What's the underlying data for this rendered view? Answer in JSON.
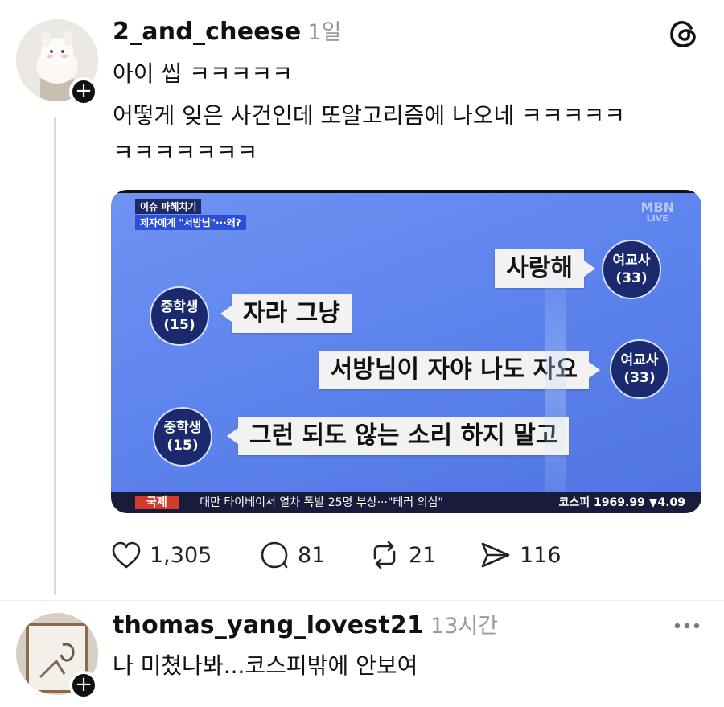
{
  "post": {
    "username": "2_and_cheese",
    "time": "1일",
    "lines": [
      "아이 씹 ㅋㅋㅋㅋㅋ",
      "어떻게 잊은 사건인데 또알고리즘에 나오네 ㅋㅋㅋㅋㅋ",
      "ㅋㅋㅋㅋㅋㅋㅋ"
    ],
    "media": {
      "tag_top": "이슈 파헤치기",
      "tag_bottom": "제자에게 \"서방님\"···왜?",
      "logo": "MBN",
      "logo_sub": "LIVE",
      "messages": [
        {
          "speaker": "여교사",
          "age": "(33)",
          "text": "사랑해",
          "side": "right"
        },
        {
          "speaker": "중학생",
          "age": "(15)",
          "text": "자라 그냥",
          "side": "left"
        },
        {
          "speaker": "여교사",
          "age": "(33)",
          "text": "서방님이 자야 나도 자요",
          "side": "right"
        },
        {
          "speaker": "중학생",
          "age": "(15)",
          "text": "그런 되도 않는 소리 하지 말고",
          "side": "left"
        }
      ],
      "ticker_label": "국제",
      "ticker_text": "대만 타이베이서 열차 폭발 25명 부상···\"테러 의심\"",
      "ticker_index": "코스피 1969.99 ▼4.09"
    },
    "actions": {
      "likes": "1,305",
      "comments": "81",
      "reposts": "21",
      "shares": "116"
    }
  },
  "reply": {
    "username": "thomas_yang_lovest21",
    "time": "13시간",
    "text": "나 미쳤나봐...코스피밖에 안보여"
  },
  "icons": {
    "threads_logo": "threads-logo-icon",
    "like": "heart-icon",
    "comment": "comment-bubble-icon",
    "repost": "repost-icon",
    "share": "send-icon",
    "more": "more-dots-icon",
    "follow": "plus-icon"
  }
}
